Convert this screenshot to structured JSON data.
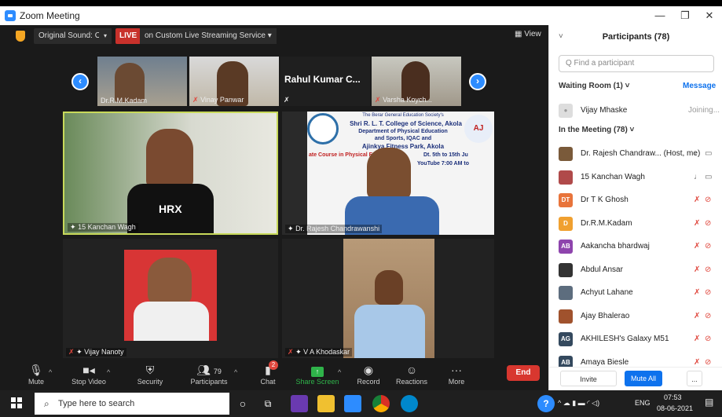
{
  "window": {
    "title": "Zoom Meeting",
    "min": "—",
    "restore": "❐",
    "close": "✕"
  },
  "topbar": {
    "sound": "Original Sound: On",
    "sound_caret": "▾",
    "live": "LIVE",
    "live_text": "on Custom Live Streaming Service ▾",
    "view": "▦ View"
  },
  "filmstrip": [
    {
      "name": "Dr.R.M.Kadam"
    },
    {
      "name": "Vinay Panwar"
    },
    {
      "name": "Rahul  Kumar  C...",
      "mic": "✗"
    },
    {
      "name": "Varsha Koych..."
    }
  ],
  "tiles": [
    {
      "name": "15 Kanchan Wagh"
    },
    {
      "name": "Dr. Rajesh Chandrawanshi"
    },
    {
      "name": "Vijay Nanoty"
    },
    {
      "name": "V A Khodaskar"
    }
  ],
  "banner": {
    "l1": "The Berar General Education Society's",
    "l2": "Shri R. L. T. College of Science, Akola",
    "l3": "Department of Physical Education",
    "l4": "and Sports, IQAC and",
    "l5": "Ajinkya Fitness Park, Akola",
    "l6": "Dt. 5th to 15th Ju",
    "l7": "ate Course in Physical F",
    "l8": "YouTube 7:00 AM to"
  },
  "shirt_text": "HRX",
  "toolbar": {
    "mute": "Mute",
    "stop_video": "Stop Video",
    "security": "Security",
    "participants": "Participants",
    "participants_count": "79",
    "chat": "Chat",
    "chat_badge": "2",
    "share": "Share Screen",
    "record": "Record",
    "reactions": "Reactions",
    "more": "More",
    "end": "End"
  },
  "panel": {
    "title": "Participants (78)",
    "find_placeholder": "Q Find a participant",
    "waiting": "Waiting Room (1)  ˅",
    "message": "Message",
    "waiting_person": {
      "name": "Vijay Mhaske",
      "status": "Joining..."
    },
    "in_meeting": "In the Meeting (78)  ˅",
    "people": [
      {
        "name": "Dr. Rajesh Chandraw...  (Host, me)",
        "initials": "",
        "color": "#7a5a3a",
        "muted": false
      },
      {
        "name": "15 Kanchan Wagh",
        "initials": "",
        "color": "#b04a4a",
        "muted": false
      },
      {
        "name": "Dr T K Ghosh",
        "initials": "DT",
        "color": "#e8743b",
        "muted": true
      },
      {
        "name": "Dr.R.M.Kadam",
        "initials": "D",
        "color": "#f0a030",
        "muted": true
      },
      {
        "name": "Aakancha bhardwaj",
        "initials": "AB",
        "color": "#8e44ad",
        "muted": true
      },
      {
        "name": "Abdul Ansar",
        "initials": "",
        "color": "#333333",
        "muted": true
      },
      {
        "name": "Achyut Lahane",
        "initials": "",
        "color": "#5d6d7e",
        "muted": true
      },
      {
        "name": "Ajay Bhalerao",
        "initials": "",
        "color": "#a0522d",
        "muted": true
      },
      {
        "name": "AKHILESH's Galaxy M51",
        "initials": "AG",
        "color": "#34495e",
        "muted": true
      },
      {
        "name": "Amaya Biesle",
        "initials": "AB",
        "color": "#34495e",
        "muted": true
      }
    ],
    "invite": "Invite",
    "mute_all": "Mute All",
    "more": "..."
  },
  "taskbar": {
    "search": "Type here to search",
    "lang": "ENG",
    "time": "07:53",
    "date": "08-06-2021"
  }
}
